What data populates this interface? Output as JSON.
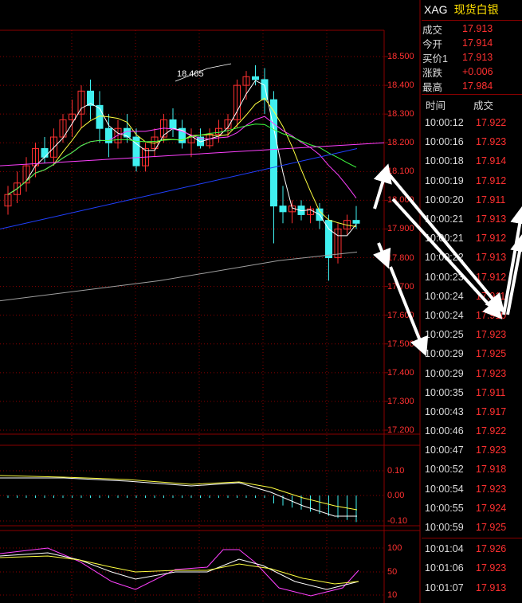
{
  "header": {
    "symbol": "XAG",
    "name": "现货白银"
  },
  "quote": [
    {
      "label": "成交",
      "value": "17.913",
      "style": "red"
    },
    {
      "label": "今开",
      "value": "17.914",
      "style": "red"
    },
    {
      "label": "买价1",
      "value": "17.913",
      "style": "red"
    },
    {
      "label": "涨跌",
      "value": "+0.006",
      "style": "red"
    },
    {
      "label": "最高",
      "value": "17.984",
      "style": "red"
    }
  ],
  "ticks_header": {
    "time": "时间",
    "price": "成交"
  },
  "ticks": [
    {
      "time": "10:00:12",
      "price": "17.922",
      "style": "red"
    },
    {
      "time": "10:00:16",
      "price": "17.923",
      "style": "red"
    },
    {
      "time": "10:00:18",
      "price": "17.914",
      "style": "red"
    },
    {
      "time": "10:00:19",
      "price": "17.912",
      "style": "red"
    },
    {
      "time": "10:00:20",
      "price": "17.911",
      "style": "red"
    },
    {
      "time": "10:00:21",
      "price": "17.913",
      "style": "red"
    },
    {
      "time": "10:00:21",
      "price": "17.912",
      "style": "red"
    },
    {
      "time": "10:00:22",
      "price": "17.913",
      "style": "red"
    },
    {
      "time": "10:00:23",
      "price": "17.912",
      "style": "red"
    },
    {
      "time": "10:00:24",
      "price": "17.911",
      "style": "red"
    },
    {
      "time": "10:00:24",
      "price": "17.910",
      "style": "red"
    },
    {
      "time": "10:00:25",
      "price": "17.923",
      "style": "red"
    },
    {
      "time": "10:00:29",
      "price": "17.925",
      "style": "red"
    },
    {
      "time": "10:00:29",
      "price": "17.923",
      "style": "red"
    },
    {
      "time": "10:00:35",
      "price": "17.911",
      "style": "red"
    },
    {
      "time": "10:00:43",
      "price": "17.917",
      "style": "red"
    },
    {
      "time": "10:00:46",
      "price": "17.922",
      "style": "red"
    },
    {
      "time": "10:00:47",
      "price": "17.923",
      "style": "red"
    },
    {
      "time": "10:00:52",
      "price": "17.918",
      "style": "red"
    },
    {
      "time": "10:00:54",
      "price": "17.923",
      "style": "red"
    },
    {
      "time": "10:00:55",
      "price": "17.924",
      "style": "red"
    },
    {
      "time": "10:00:59",
      "price": "17.925",
      "style": "red"
    },
    {
      "time": "10:01:04",
      "price": "17.926",
      "style": "red"
    },
    {
      "time": "10:01:06",
      "price": "17.923",
      "style": "red"
    },
    {
      "time": "10:01:07",
      "price": "17.913",
      "style": "red"
    }
  ],
  "main_chart": {
    "peak_label": "18.465",
    "y_ticks": [
      "18.500",
      "18.400",
      "18.300",
      "18.200",
      "18.100",
      "18.000",
      "17.900",
      "17.800",
      "17.700",
      "17.600",
      "17.500",
      "17.400",
      "17.300",
      "17.200"
    ],
    "ylim": [
      17.2,
      18.55
    ]
  },
  "macd_chart": {
    "y_ticks": [
      "0.10",
      "0.00",
      "-0.10"
    ]
  },
  "kdj_chart": {
    "y_ticks": [
      "100",
      "50",
      "10"
    ]
  },
  "colors": {
    "up": "#ff3030",
    "down": "#40f0f0",
    "grid": "#8a0000",
    "ma_white": "#ffffff",
    "ma_yellow": "#ffff40",
    "ma_magenta": "#ff40ff",
    "ma_green": "#40ff40",
    "ma_blue": "#2040ff",
    "ma_gray": "#a0a0a0"
  },
  "candles": [
    {
      "o": 17.98,
      "h": 18.05,
      "l": 17.95,
      "c": 18.02
    },
    {
      "o": 18.02,
      "h": 18.1,
      "l": 17.99,
      "c": 18.06
    },
    {
      "o": 18.06,
      "h": 18.15,
      "l": 18.03,
      "c": 18.12
    },
    {
      "o": 18.12,
      "h": 18.2,
      "l": 18.08,
      "c": 18.18
    },
    {
      "o": 18.18,
      "h": 18.22,
      "l": 18.13,
      "c": 18.15
    },
    {
      "o": 18.15,
      "h": 18.25,
      "l": 18.12,
      "c": 18.22
    },
    {
      "o": 18.22,
      "h": 18.3,
      "l": 18.2,
      "c": 18.28
    },
    {
      "o": 18.28,
      "h": 18.35,
      "l": 18.22,
      "c": 18.3
    },
    {
      "o": 18.3,
      "h": 18.4,
      "l": 18.25,
      "c": 18.38
    },
    {
      "o": 18.38,
      "h": 18.42,
      "l": 18.28,
      "c": 18.33
    },
    {
      "o": 18.33,
      "h": 18.38,
      "l": 18.2,
      "c": 18.25
    },
    {
      "o": 18.25,
      "h": 18.3,
      "l": 18.15,
      "c": 18.2
    },
    {
      "o": 18.2,
      "h": 18.28,
      "l": 18.18,
      "c": 18.25
    },
    {
      "o": 18.25,
      "h": 18.3,
      "l": 18.2,
      "c": 18.22
    },
    {
      "o": 18.22,
      "h": 18.25,
      "l": 18.1,
      "c": 18.12
    },
    {
      "o": 18.12,
      "h": 18.2,
      "l": 18.1,
      "c": 18.18
    },
    {
      "o": 18.18,
      "h": 18.25,
      "l": 18.15,
      "c": 18.22
    },
    {
      "o": 18.22,
      "h": 18.3,
      "l": 18.2,
      "c": 18.28
    },
    {
      "o": 18.28,
      "h": 18.32,
      "l": 18.22,
      "c": 18.25
    },
    {
      "o": 18.25,
      "h": 18.28,
      "l": 18.18,
      "c": 18.2
    },
    {
      "o": 18.2,
      "h": 18.25,
      "l": 18.15,
      "c": 18.22
    },
    {
      "o": 18.22,
      "h": 18.25,
      "l": 18.18,
      "c": 18.19
    },
    {
      "o": 18.19,
      "h": 18.25,
      "l": 18.18,
      "c": 18.23
    },
    {
      "o": 18.23,
      "h": 18.28,
      "l": 18.2,
      "c": 18.25
    },
    {
      "o": 18.25,
      "h": 18.3,
      "l": 18.22,
      "c": 18.28
    },
    {
      "o": 18.28,
      "h": 18.42,
      "l": 18.25,
      "c": 18.4
    },
    {
      "o": 18.4,
      "h": 18.45,
      "l": 18.35,
      "c": 18.43
    },
    {
      "o": 18.43,
      "h": 18.47,
      "l": 18.4,
      "c": 18.42
    },
    {
      "o": 18.42,
      "h": 18.46,
      "l": 18.3,
      "c": 18.35
    },
    {
      "o": 18.35,
      "h": 18.38,
      "l": 17.85,
      "c": 17.98
    },
    {
      "o": 17.98,
      "h": 18.05,
      "l": 17.92,
      "c": 17.96
    },
    {
      "o": 17.96,
      "h": 18.0,
      "l": 17.92,
      "c": 17.98
    },
    {
      "o": 17.98,
      "h": 18.0,
      "l": 17.93,
      "c": 17.95
    },
    {
      "o": 17.95,
      "h": 17.98,
      "l": 17.92,
      "c": 17.97
    },
    {
      "o": 17.97,
      "h": 17.99,
      "l": 17.9,
      "c": 17.93
    },
    {
      "o": 17.93,
      "h": 17.95,
      "l": 17.72,
      "c": 17.8
    },
    {
      "o": 17.8,
      "h": 17.92,
      "l": 17.78,
      "c": 17.9
    },
    {
      "o": 17.9,
      "h": 17.95,
      "l": 17.88,
      "c": 17.93
    },
    {
      "o": 17.93,
      "h": 17.98,
      "l": 17.9,
      "c": 17.92
    }
  ]
}
